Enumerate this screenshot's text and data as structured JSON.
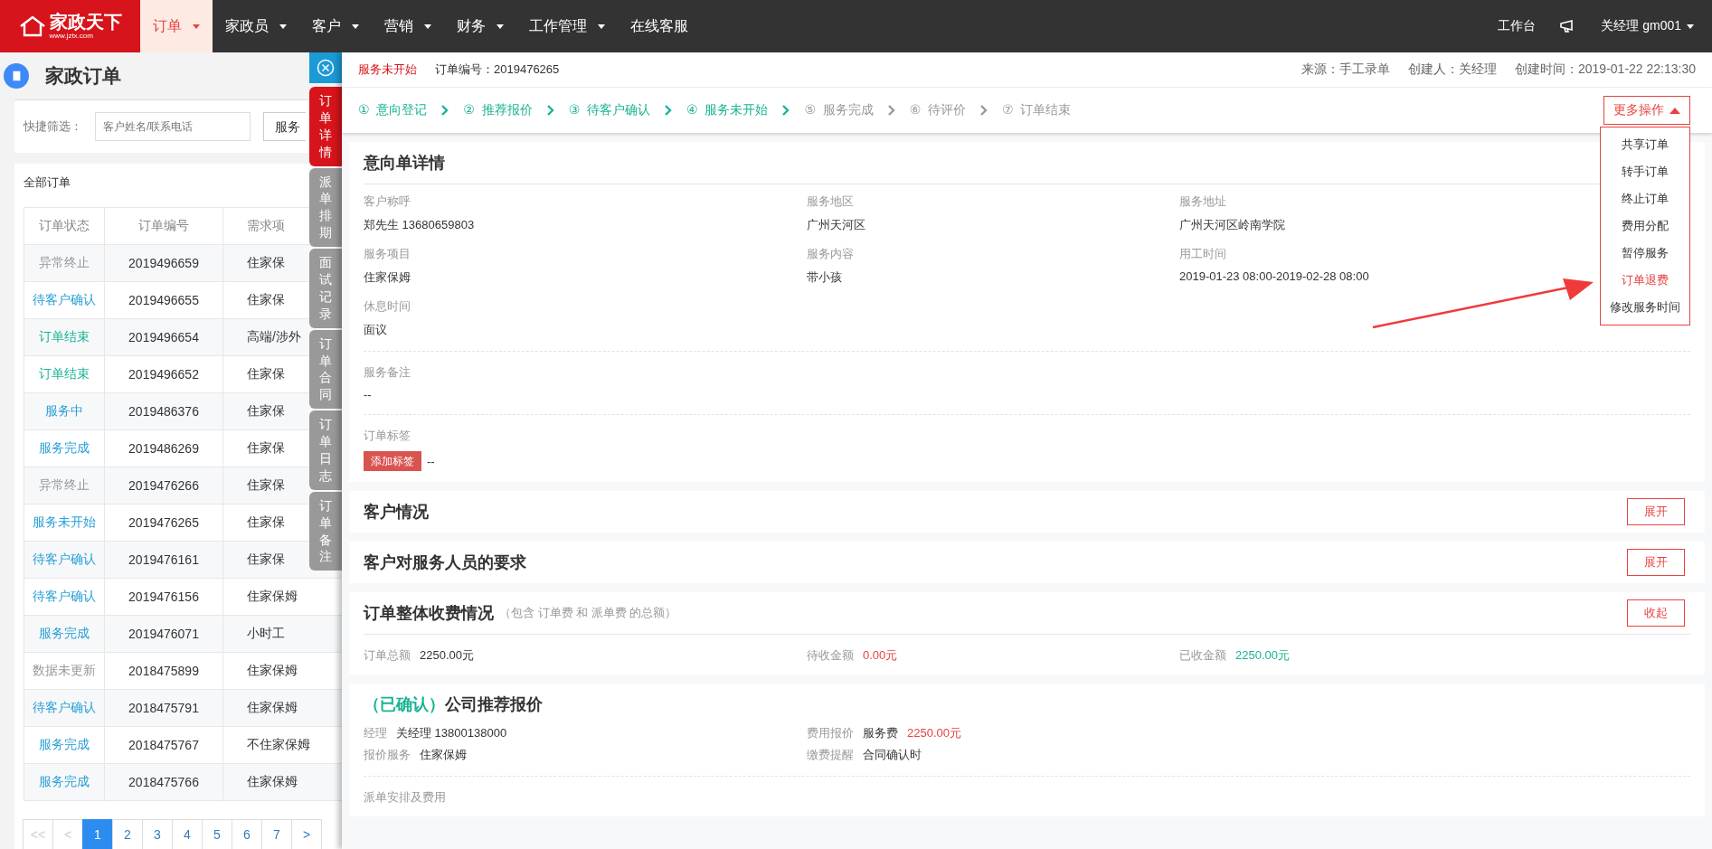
{
  "logo": {
    "name": "家政天下",
    "url": "www.jztx.com"
  },
  "nav": [
    {
      "label": "订单",
      "dropdown": true,
      "selected": true
    },
    {
      "label": "家政员",
      "dropdown": true,
      "selected": false
    },
    {
      "label": "客户",
      "dropdown": true,
      "selected": false
    },
    {
      "label": "营销",
      "dropdown": true,
      "selected": false
    },
    {
      "label": "财务",
      "dropdown": true,
      "selected": false
    },
    {
      "label": "工作管理",
      "dropdown": true,
      "selected": false
    },
    {
      "label": "在线客服",
      "dropdown": false,
      "selected": false
    }
  ],
  "nav_right": {
    "workbench": "工作台",
    "user": "关经理  gm001"
  },
  "page": {
    "title": "家政订单",
    "filter_label": "快捷筛选：",
    "search_placeholder": "客户姓名/联系电话",
    "select_value": "服务",
    "list_title": "全部订单"
  },
  "table": {
    "columns": [
      "订单状态",
      "订单编号",
      "需求项"
    ],
    "rows": [
      {
        "status": "异常终止",
        "color": "#999999",
        "number": "2019496659",
        "item": "住家保"
      },
      {
        "status": "待客户确认",
        "color": "#2a9fd6",
        "number": "2019496655",
        "item": "住家保"
      },
      {
        "status": "订单结束",
        "color": "#1ab394",
        "number": "2019496654",
        "item": "高端/涉外"
      },
      {
        "status": "订单结束",
        "color": "#1ab394",
        "number": "2019496652",
        "item": "住家保"
      },
      {
        "status": "服务中",
        "color": "#2a9fd6",
        "number": "2019486376",
        "item": "住家保"
      },
      {
        "status": "服务完成",
        "color": "#2a9fd6",
        "number": "2019486269",
        "item": "住家保"
      },
      {
        "status": "异常终止",
        "color": "#999999",
        "number": "2019476266",
        "item": "住家保"
      },
      {
        "status": "服务未开始",
        "color": "#2a9fd6",
        "number": "2019476265",
        "item": "住家保"
      },
      {
        "status": "待客户确认",
        "color": "#2a9fd6",
        "number": "2019476161",
        "item": "住家保"
      },
      {
        "status": "待客户确认",
        "color": "#2a9fd6",
        "number": "2019476156",
        "item": "住家保姆"
      },
      {
        "status": "服务完成",
        "color": "#2a9fd6",
        "number": "2019476071",
        "item": "小时工"
      },
      {
        "status": "数据未更新",
        "color": "#999999",
        "number": "2018475899",
        "item": "住家保姆"
      },
      {
        "status": "待客户确认",
        "color": "#2a9fd6",
        "number": "2018475791",
        "item": "住家保姆"
      },
      {
        "status": "服务完成",
        "color": "#2a9fd6",
        "number": "2018475767",
        "item": "不住家保姆"
      },
      {
        "status": "服务完成",
        "color": "#2a9fd6",
        "number": "2018475766",
        "item": "住家保姆"
      }
    ]
  },
  "pagination": [
    {
      "label": "<<",
      "selected": false,
      "disabled": true
    },
    {
      "label": "<",
      "selected": false,
      "disabled": true
    },
    {
      "label": "1",
      "selected": true,
      "disabled": false
    },
    {
      "label": "2",
      "selected": false,
      "disabled": false
    },
    {
      "label": "3",
      "selected": false,
      "disabled": false
    },
    {
      "label": "4",
      "selected": false,
      "disabled": false
    },
    {
      "label": "5",
      "selected": false,
      "disabled": false
    },
    {
      "label": "6",
      "selected": false,
      "disabled": false
    },
    {
      "label": "7",
      "selected": false,
      "disabled": false
    },
    {
      "label": ">",
      "selected": false,
      "disabled": false
    }
  ],
  "side_tabs": [
    {
      "label": "订单详情",
      "selected": true
    },
    {
      "label": "派单排期",
      "selected": false
    },
    {
      "label": "面试记录",
      "selected": false
    },
    {
      "label": "订单合同",
      "selected": false
    },
    {
      "label": "订单日志",
      "selected": false
    },
    {
      "label": "订单备注",
      "selected": false
    }
  ],
  "drawer": {
    "status": "服务未开始",
    "order_no": "订单编号：2019476265",
    "source": "来源：手工录单",
    "creator": "创建人：关经理",
    "created": "创建时间：2019-01-22 22:13:30",
    "steps": [
      {
        "num": "①",
        "label": "意向登记",
        "done": true
      },
      {
        "num": "②",
        "label": "推荐报价",
        "done": true
      },
      {
        "num": "③",
        "label": "待客户确认",
        "done": true
      },
      {
        "num": "④",
        "label": "服务未开始",
        "done": true
      },
      {
        "num": "⑤",
        "label": "服务完成",
        "done": false
      },
      {
        "num": "⑥",
        "label": "待评价",
        "done": false
      },
      {
        "num": "⑦",
        "label": "订单结束",
        "done": false
      }
    ],
    "more": {
      "label": "更多操作",
      "expanded": true,
      "items": [
        {
          "label": "共享订单",
          "selected": false
        },
        {
          "label": "转手订单",
          "selected": false
        },
        {
          "label": "终止订单",
          "selected": false
        },
        {
          "label": "费用分配",
          "selected": false
        },
        {
          "label": "暂停服务",
          "selected": false
        },
        {
          "label": "订单退费",
          "selected": true
        },
        {
          "label": "修改服务时间",
          "selected": false
        }
      ]
    },
    "intent": {
      "title": "意向单详情",
      "fields": [
        {
          "label": "客户称呼",
          "value": "郑先生 13680659803"
        },
        {
          "label": "服务地区",
          "value": "广州天河区"
        },
        {
          "label": "服务地址",
          "value": "广州天河区岭南学院"
        },
        {
          "label": "服务项目",
          "value": "住家保姆"
        },
        {
          "label": "服务内容",
          "value": "带小孩"
        },
        {
          "label": "用工时间",
          "value": "2019-01-23 08:00-2019-02-28 08:00"
        },
        {
          "label": "休息时间",
          "value": "面议"
        }
      ],
      "remark_label": "服务备注",
      "remark": "--",
      "tag_label": "订单标签",
      "tag_button": "添加标签",
      "tags": "--"
    },
    "collapsed": [
      {
        "title": "客户情况",
        "button": "展开"
      },
      {
        "title": "客户对服务人员的要求",
        "button": "展开"
      }
    ],
    "charges": {
      "title": "订单整体收费情况",
      "note": "（包含 订单费 和 派单费 的总额）",
      "button": "收起",
      "items": [
        {
          "label": "订单总额",
          "value": "2250.00元",
          "kind": "plain"
        },
        {
          "label": "待收金额",
          "value": "0.00元",
          "kind": "due"
        },
        {
          "label": "已收金额",
          "value": "2250.00元",
          "kind": "paid"
        }
      ]
    },
    "quote": {
      "state": "（已确认）",
      "title": "公司推荐报价",
      "rows": [
        {
          "label": "经理",
          "value": "关经理 13800138000",
          "kind": "plain"
        },
        {
          "label": "费用报价",
          "prefix": "服务费",
          "value": "2250.00元",
          "kind": "price"
        },
        {
          "label": "报价服务",
          "value": "住家保姆",
          "kind": "plain"
        },
        {
          "label": "缴费提醒",
          "value": "合同确认时",
          "kind": "plain"
        }
      ],
      "dispatch_label": "派单安排及费用"
    }
  }
}
